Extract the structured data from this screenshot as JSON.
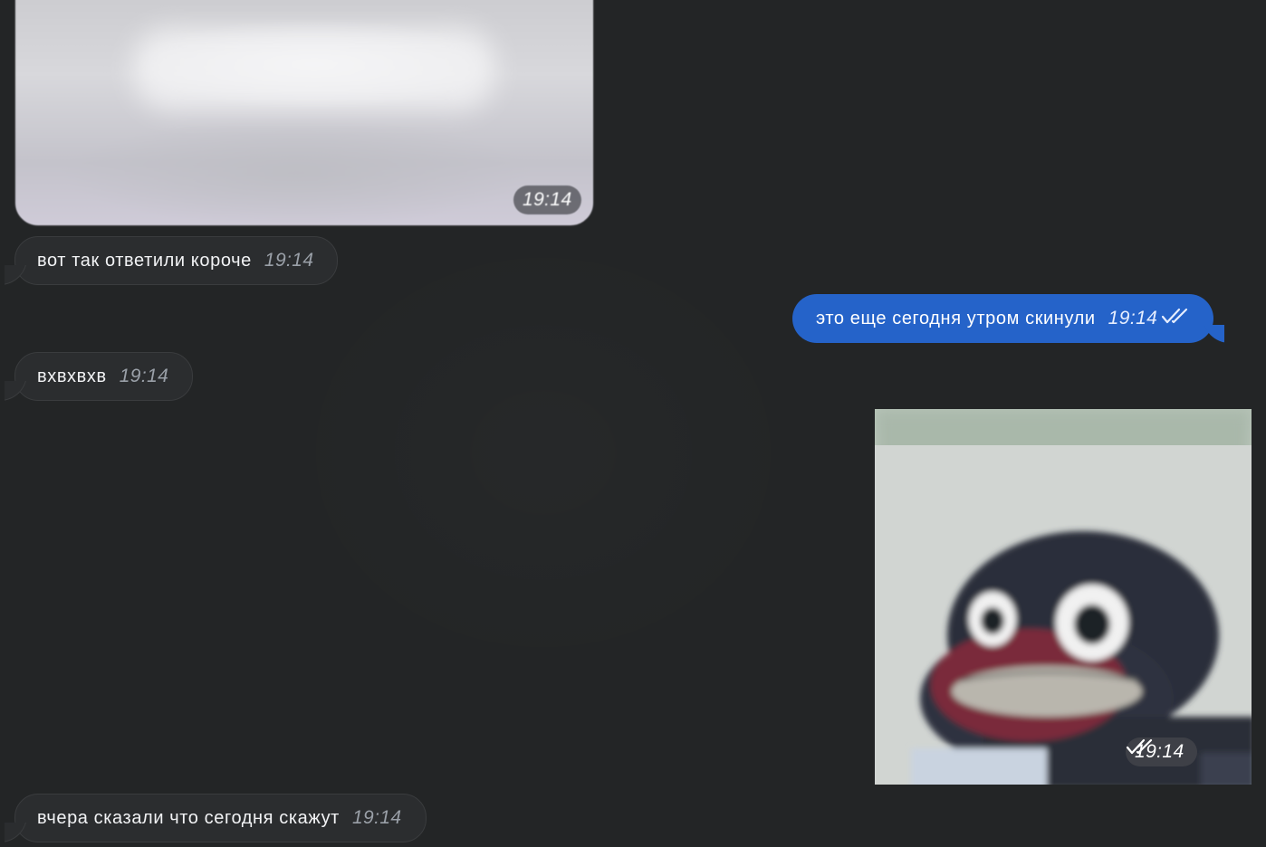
{
  "messages": [
    {
      "direction": "incoming",
      "type": "photo",
      "time": "19:14"
    },
    {
      "direction": "incoming",
      "type": "text",
      "text": "вот так ответили короче",
      "time": "19:14"
    },
    {
      "direction": "outgoing",
      "type": "text",
      "text": "это еще сегодня утром скинули",
      "time": "19:14",
      "read": true
    },
    {
      "direction": "incoming",
      "type": "text",
      "text": "вхвхвхв",
      "time": "19:14"
    },
    {
      "direction": "outgoing",
      "type": "photo",
      "time": "19:14",
      "read": true
    },
    {
      "direction": "incoming",
      "type": "text",
      "text": "вчера сказали что сегодня скажут",
      "time": "19:14"
    }
  ],
  "colors": {
    "background": "#232526",
    "incoming_bubble": "#2b2d2f",
    "outgoing_bubble": "#2563c9",
    "timestamp_incoming": "#9aa0a8"
  },
  "icons": {
    "read_receipt": "double-check-icon"
  }
}
